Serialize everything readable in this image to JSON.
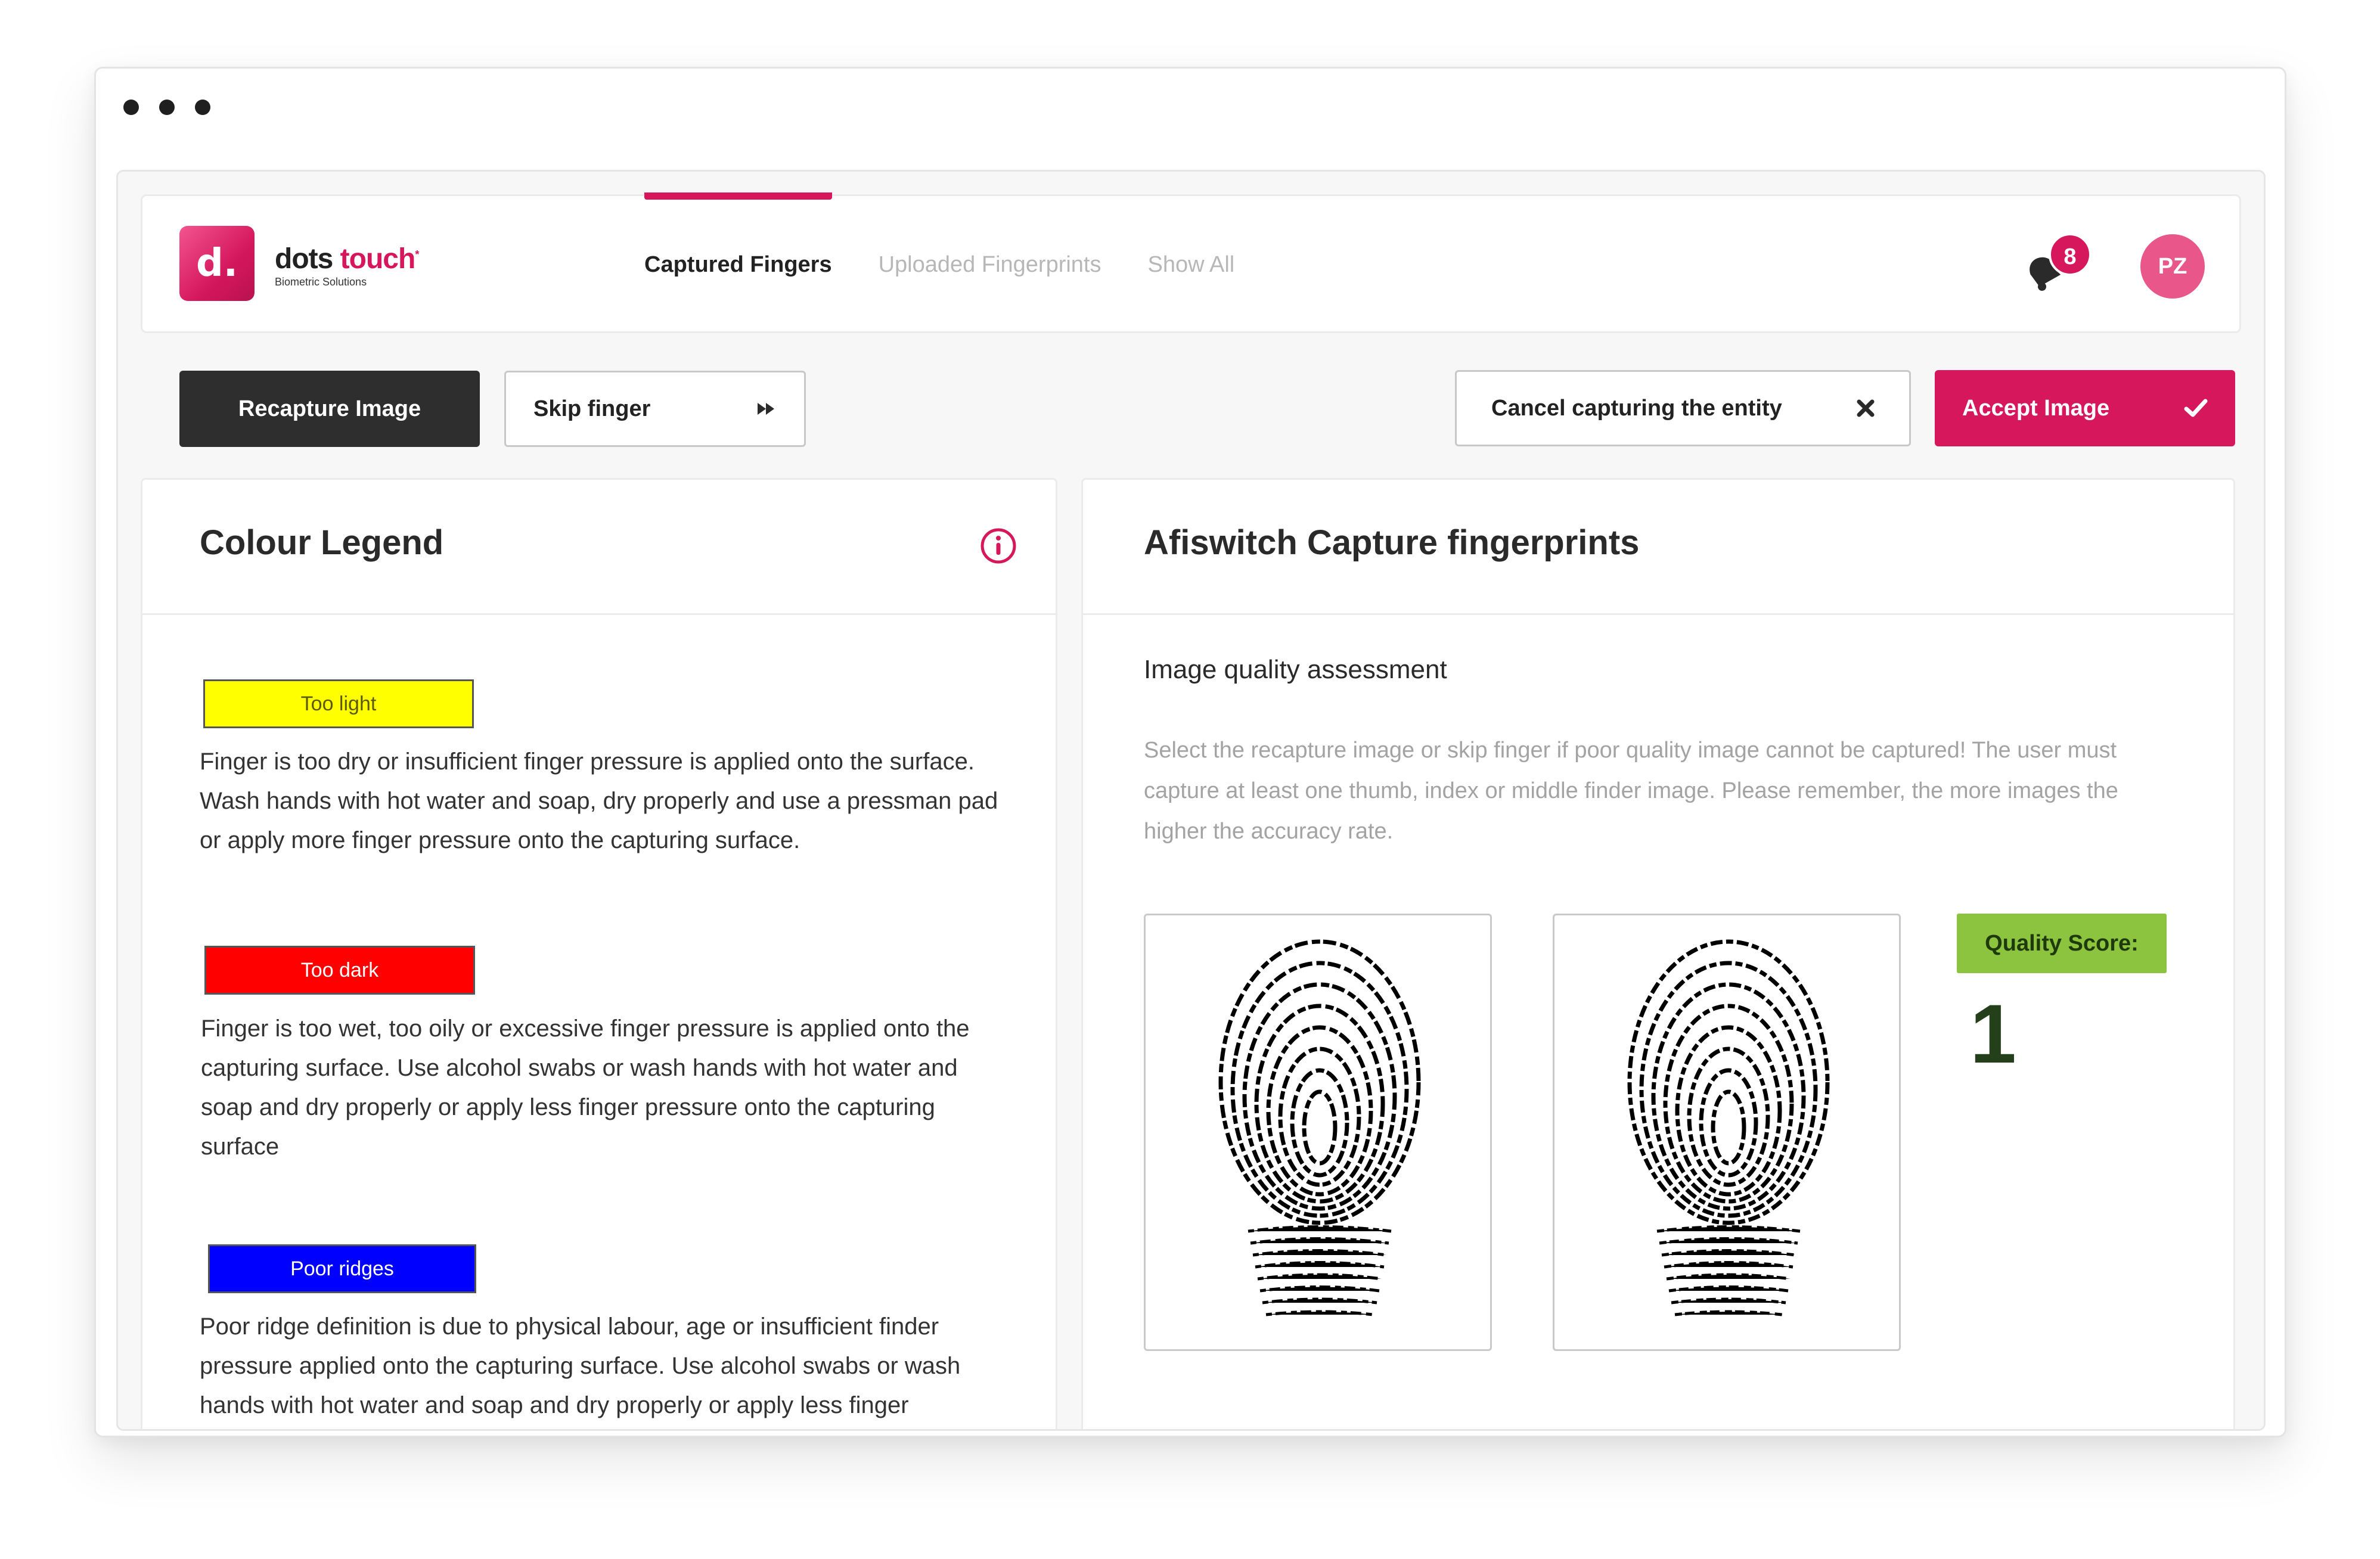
{
  "brand": {
    "logo_letter": "d.",
    "name_part1": "dots",
    "name_part2": "touch",
    "trademark": "*",
    "subtitle": "Biometric Solutions",
    "accent_color": "#d6175c"
  },
  "nav": {
    "tabs": [
      {
        "label": "Captured Fingers",
        "active": true
      },
      {
        "label": "Uploaded Fingerprints",
        "active": false
      },
      {
        "label": "Show All",
        "active": false
      }
    ]
  },
  "header": {
    "notification_icon": "bell-icon",
    "notification_count": "8",
    "user_initials": "PZ"
  },
  "toolbar": {
    "recapture_label": "Recapture Image",
    "skip_label": "Skip finger",
    "skip_icon": "fast-forward-icon",
    "cancel_label": "Cancel capturing the entity",
    "cancel_icon": "close-icon",
    "accept_label": "Accept Image",
    "accept_icon": "check-icon"
  },
  "legend": {
    "title": "Colour Legend",
    "info_icon": "info-icon",
    "items": [
      {
        "label": "Too light",
        "color": "#ffff00",
        "text_color": "#5a5a00",
        "description": "Finger is too dry or insufficient finger pressure is applied onto the surface. Wash hands with hot water and soap, dry properly and use a pressman pad or apply more finger pressure onto the capturing surface."
      },
      {
        "label": "Too dark",
        "color": "#ff0000",
        "text_color": "#ffffff",
        "description": "Finger is too wet, too oily or excessive finger pressure is applied onto the capturing surface. Use alcohol swabs or wash hands with hot water and soap and dry properly or apply less finger pressure onto the capturing surface"
      },
      {
        "label": "Poor ridges",
        "color": "#0000ff",
        "text_color": "#ffffff",
        "description": "Poor ridge definition is due to physical labour, age or insufficient finder pressure applied onto the capturing surface. Use alcohol swabs or wash hands with hot water and soap and dry properly or apply less finger"
      }
    ]
  },
  "capture": {
    "title": "Afiswitch Capture fingerprints",
    "assessment_title": "Image quality assessment",
    "assessment_description": "Select the recapture image or skip finger if poor quality image cannot be captured! The user must capture at least one thumb, index or middle finder image. Please remember, the more images the higher the accuracy rate.",
    "fingerprint_images": [
      "fingerprint-image",
      "fingerprint-image"
    ],
    "quality_label": "Quality Score:",
    "quality_score": "1",
    "quality_color": "#8cc43f"
  }
}
